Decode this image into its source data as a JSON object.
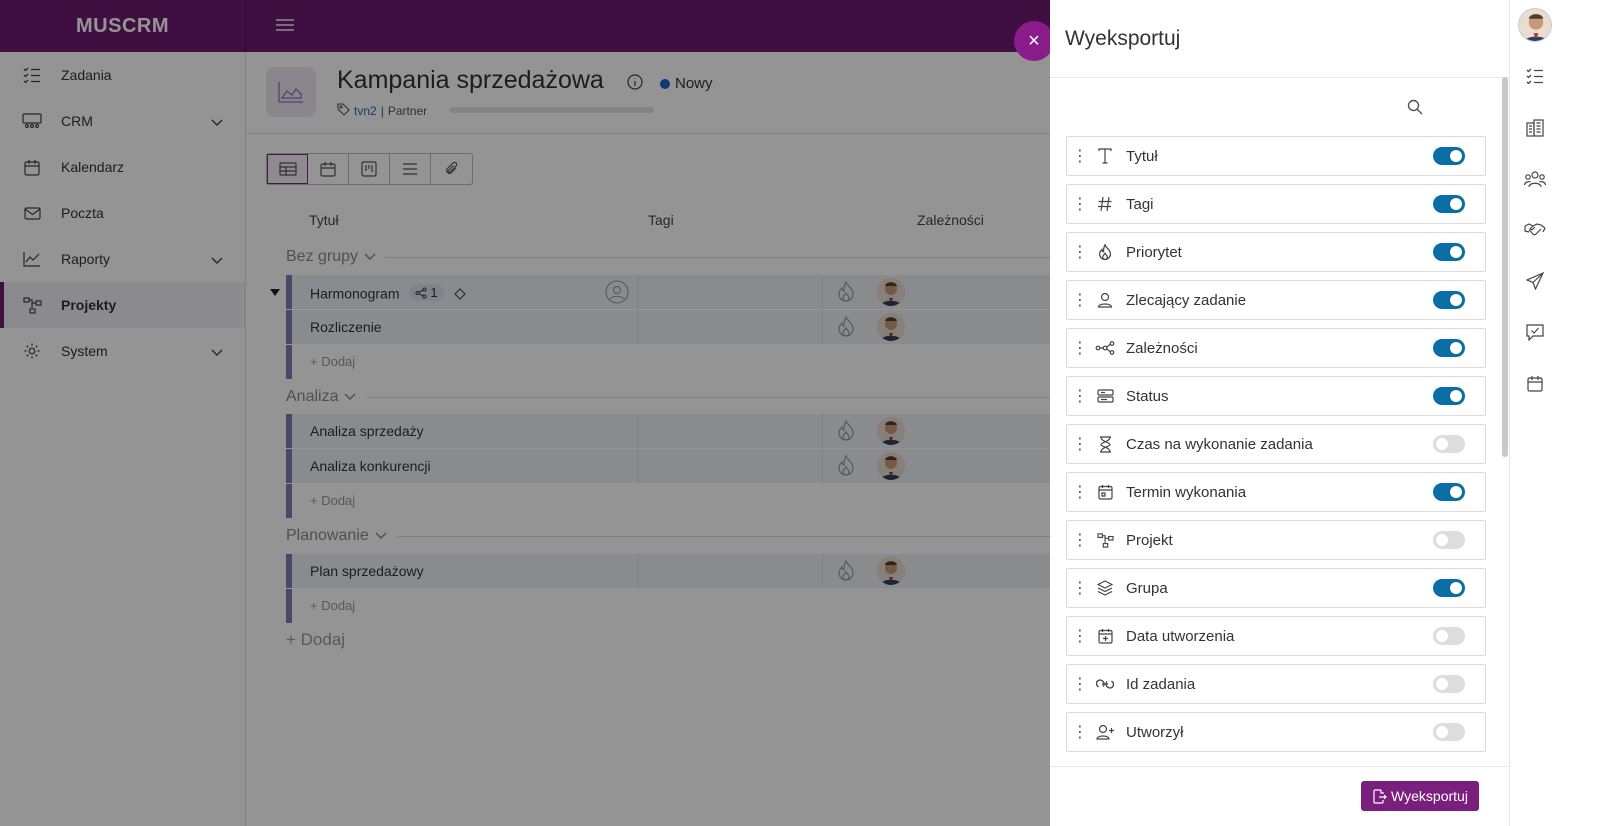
{
  "app": {
    "logo": "MUSCRM"
  },
  "sidebar": {
    "items": [
      {
        "label": "Zadania",
        "icon": "tasks-icon",
        "chevron": false
      },
      {
        "label": "CRM",
        "icon": "crm-icon",
        "chevron": true
      },
      {
        "label": "Kalendarz",
        "icon": "calendar-icon",
        "chevron": false
      },
      {
        "label": "Poczta",
        "icon": "mail-icon",
        "chevron": false
      },
      {
        "label": "Raporty",
        "icon": "chart-icon",
        "chevron": true
      },
      {
        "label": "Projekty",
        "icon": "projects-icon",
        "chevron": false,
        "active": true
      },
      {
        "label": "System",
        "icon": "gear-icon",
        "chevron": true
      }
    ]
  },
  "project": {
    "title": "Kampania sprzedażowa",
    "status": "Nowy",
    "status_color": "#1f62c8",
    "tag": "tvn2",
    "partner": "Partner"
  },
  "table": {
    "columns": {
      "title": "Tytuł",
      "tags": "Tagi",
      "deps": "Zależności"
    },
    "groups": [
      {
        "name": "Bez grupy",
        "tasks": [
          {
            "title": "Harmonogram",
            "deps_count": "1"
          },
          {
            "title": "Rozliczenie"
          }
        ],
        "add_label": "+ Dodaj"
      },
      {
        "name": "Analiza",
        "tasks": [
          {
            "title": "Analiza sprzedaży"
          },
          {
            "title": "Analiza konkurencji"
          }
        ],
        "add_label": "+ Dodaj"
      },
      {
        "name": "Planowanie",
        "tasks": [
          {
            "title": "Plan sprzedażowy"
          }
        ],
        "add_label": "+ Dodaj"
      }
    ],
    "add_label": "+ Dodaj"
  },
  "drawer": {
    "title": "Wyeksportuj",
    "close": "×",
    "fields": [
      {
        "label": "Tytuł",
        "icon": "text-icon",
        "on": true
      },
      {
        "label": "Tagi",
        "icon": "hash-icon",
        "on": true
      },
      {
        "label": "Priorytet",
        "icon": "fire-icon",
        "on": true
      },
      {
        "label": "Zlecający zadanie",
        "icon": "user-icon",
        "on": true
      },
      {
        "label": "Zależności",
        "icon": "dependency-icon",
        "on": true
      },
      {
        "label": "Status",
        "icon": "status-icon",
        "on": true
      },
      {
        "label": "Czas na wykonanie zadania",
        "icon": "hourglass-icon",
        "on": false
      },
      {
        "label": "Termin wykonania",
        "icon": "calendar-icon",
        "on": true
      },
      {
        "label": "Projekt",
        "icon": "project-icon",
        "on": false
      },
      {
        "label": "Grupa",
        "icon": "layers-icon",
        "on": true
      },
      {
        "label": "Data utworzenia",
        "icon": "calendar-plus-icon",
        "on": false
      },
      {
        "label": "Id zadania",
        "icon": "link-icon",
        "on": false
      },
      {
        "label": "Utworzył",
        "icon": "user-plus-icon",
        "on": false
      }
    ],
    "export_button": "Wyeksportuj"
  },
  "rail": {
    "items": [
      "tasks-icon",
      "building-icon",
      "people-icon",
      "handshake-icon",
      "send-icon",
      "chat-check-icon",
      "calendar-icon"
    ]
  },
  "colors": {
    "brand": "#6f1a70",
    "toggle_on": "#0a6ea2",
    "group_accent": "#8579b8"
  }
}
